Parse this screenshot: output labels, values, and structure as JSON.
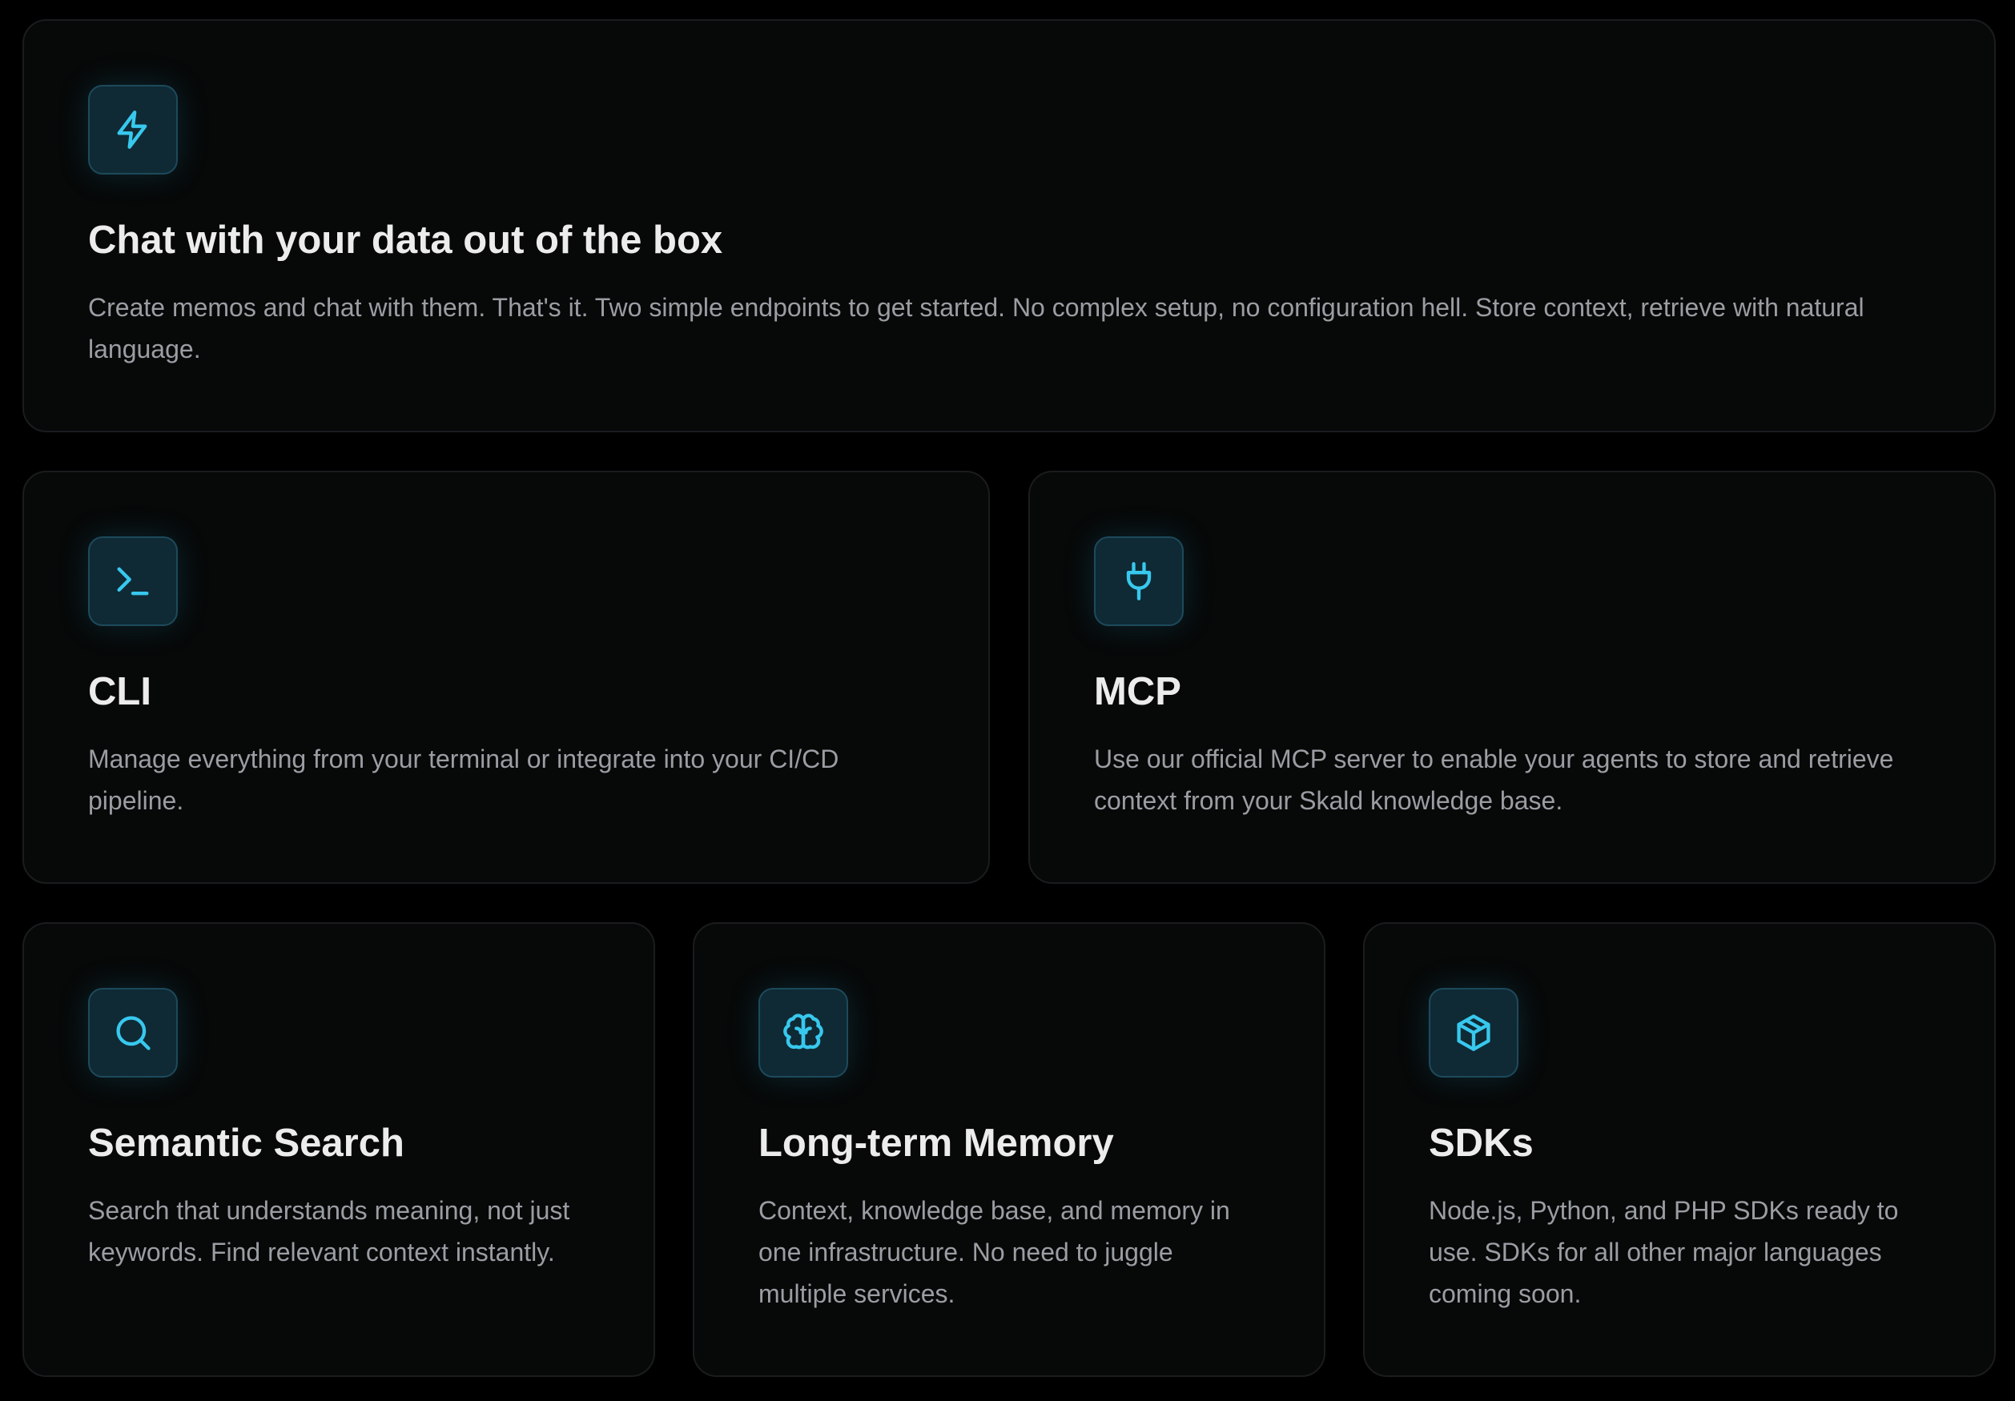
{
  "features": {
    "chat": {
      "icon": "lightning-bolt-icon",
      "title": "Chat with your data out of the box",
      "description": "Create memos and chat with them. That's it. Two simple endpoints to get started. No complex setup, no configuration hell. Store context, retrieve with natural language."
    },
    "cli": {
      "icon": "terminal-icon",
      "title": "CLI",
      "description": "Manage everything from your terminal or integrate into your CI/CD pipeline."
    },
    "mcp": {
      "icon": "plug-icon",
      "title": "MCP",
      "description": "Use our official MCP server to enable your agents to store and retrieve context from your Skald knowledge base."
    },
    "search": {
      "icon": "search-icon",
      "title": "Semantic Search",
      "description": "Search that understands meaning, not just keywords. Find relevant context instantly."
    },
    "memory": {
      "icon": "brain-icon",
      "title": "Long-term Memory",
      "description": "Context, knowledge base, and memory in one infrastructure. No need to juggle multiple services."
    },
    "sdks": {
      "icon": "package-icon",
      "title": "SDKs",
      "description": "Node.js, Python, and PHP SDKs ready to use. SDKs for all other major languages coming soon."
    }
  },
  "colors": {
    "background": "#000000",
    "card": "#070808",
    "accent": "#38c8ee",
    "title": "#ececec",
    "text": "#9a9ea3"
  }
}
